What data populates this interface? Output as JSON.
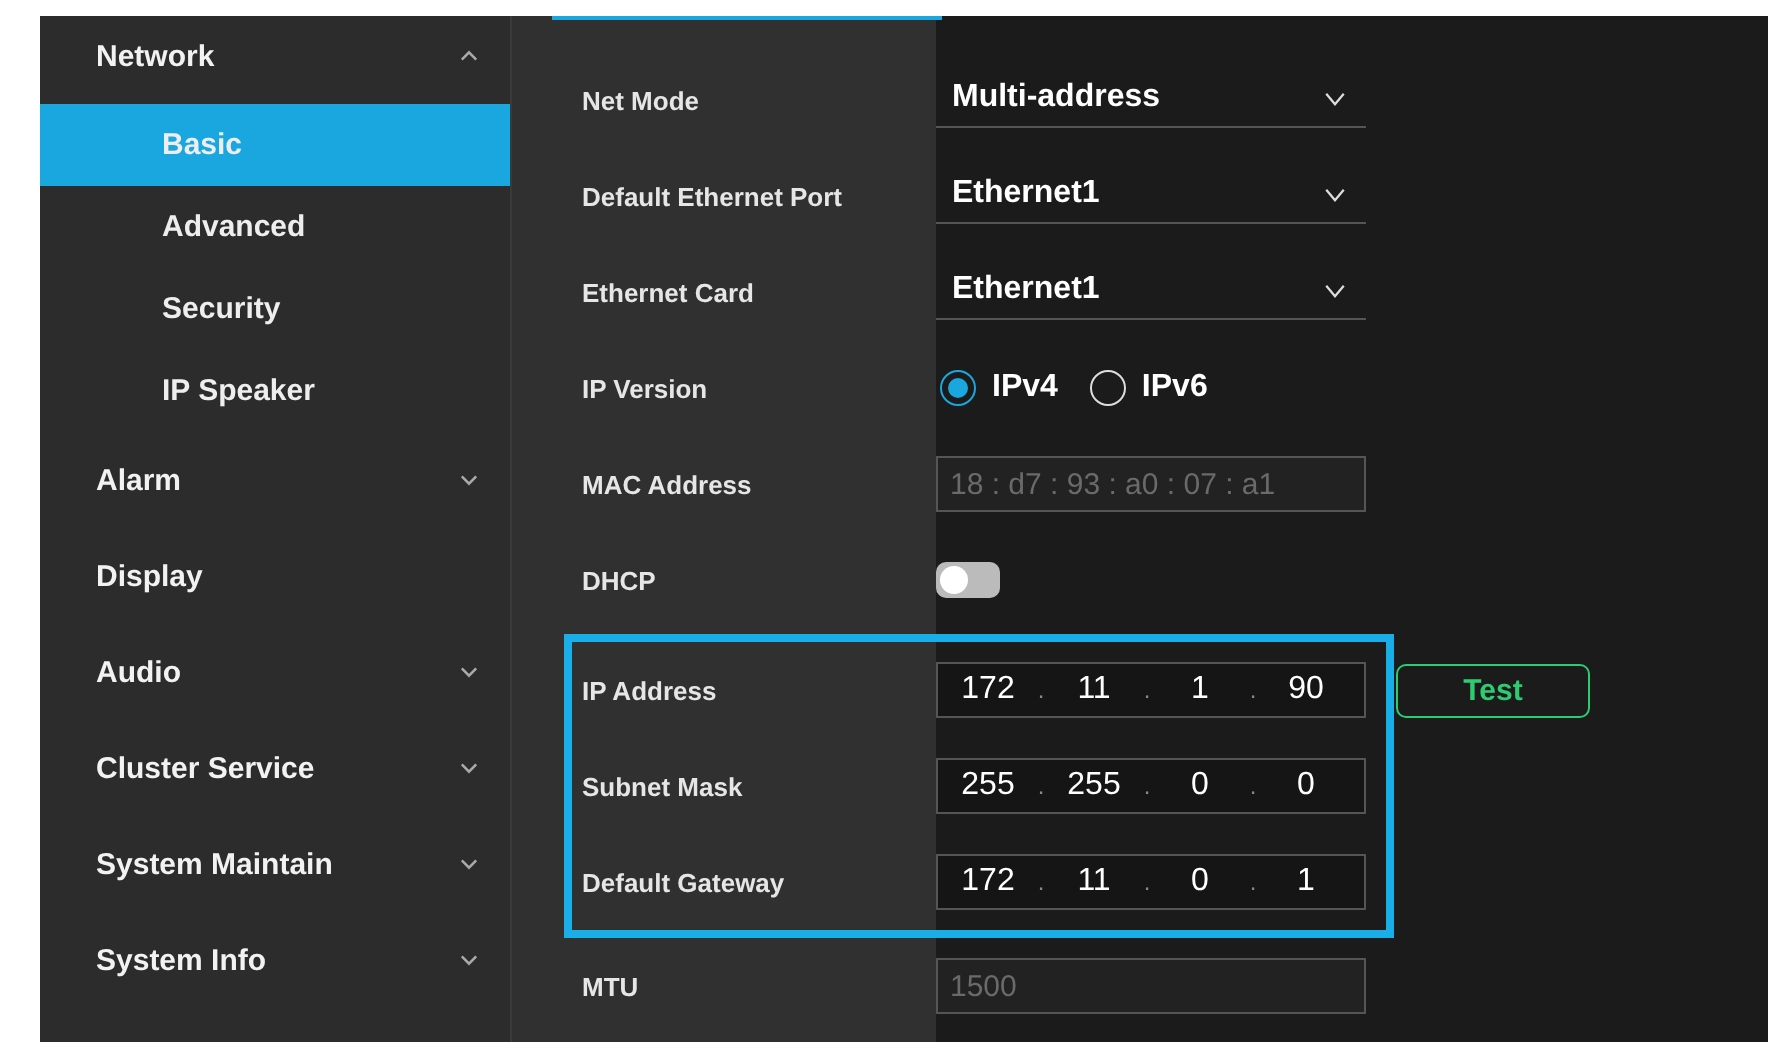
{
  "sidebar": {
    "items": [
      {
        "label": "Network",
        "expanded": true,
        "selected": false,
        "children": [
          {
            "label": "Basic",
            "selected": true
          },
          {
            "label": "Advanced",
            "selected": false
          },
          {
            "label": "Security",
            "selected": false
          },
          {
            "label": "IP Speaker",
            "selected": false
          }
        ]
      },
      {
        "label": "Alarm",
        "expanded": false,
        "selected": false
      },
      {
        "label": "Display",
        "selected": false
      },
      {
        "label": "Audio",
        "expanded": false,
        "selected": false
      },
      {
        "label": "Cluster Service",
        "expanded": false,
        "selected": false
      },
      {
        "label": "System Maintain",
        "expanded": false,
        "selected": false
      },
      {
        "label": "System Info",
        "expanded": false,
        "selected": false
      }
    ]
  },
  "form": {
    "fields": [
      {
        "kind": "select",
        "label": "Net Mode",
        "value": "Multi-address"
      },
      {
        "kind": "select",
        "label": "Default Ethernet Port",
        "value": "Ethernet1"
      },
      {
        "kind": "select",
        "label": "Ethernet Card",
        "value": "Ethernet1"
      },
      {
        "kind": "radio",
        "label": "IP Version",
        "options": [
          {
            "label": "IPv4",
            "selected": true
          },
          {
            "label": "IPv6",
            "selected": false
          }
        ]
      },
      {
        "kind": "text",
        "label": "MAC Address",
        "value": "18 : d7 : 93 : a0 : 07 : a1",
        "disabled": true
      },
      {
        "kind": "toggle",
        "label": "DHCP",
        "on": false
      }
    ],
    "highlight_box": {
      "fields": [
        {
          "kind": "ip",
          "label": "IP Address",
          "octets": [
            "172",
            "11",
            "1",
            "90"
          ],
          "separator": ".",
          "button": "Test"
        },
        {
          "kind": "ip",
          "label": "Subnet Mask",
          "octets": [
            "255",
            "255",
            "0",
            "0"
          ],
          "separator": "."
        },
        {
          "kind": "ip",
          "label": "Default Gateway",
          "octets": [
            "172",
            "11",
            "0",
            "1"
          ],
          "separator": "."
        }
      ]
    },
    "more_fields": [
      {
        "kind": "text",
        "label": "MTU",
        "value": "1500",
        "disabled": true
      }
    ]
  }
}
